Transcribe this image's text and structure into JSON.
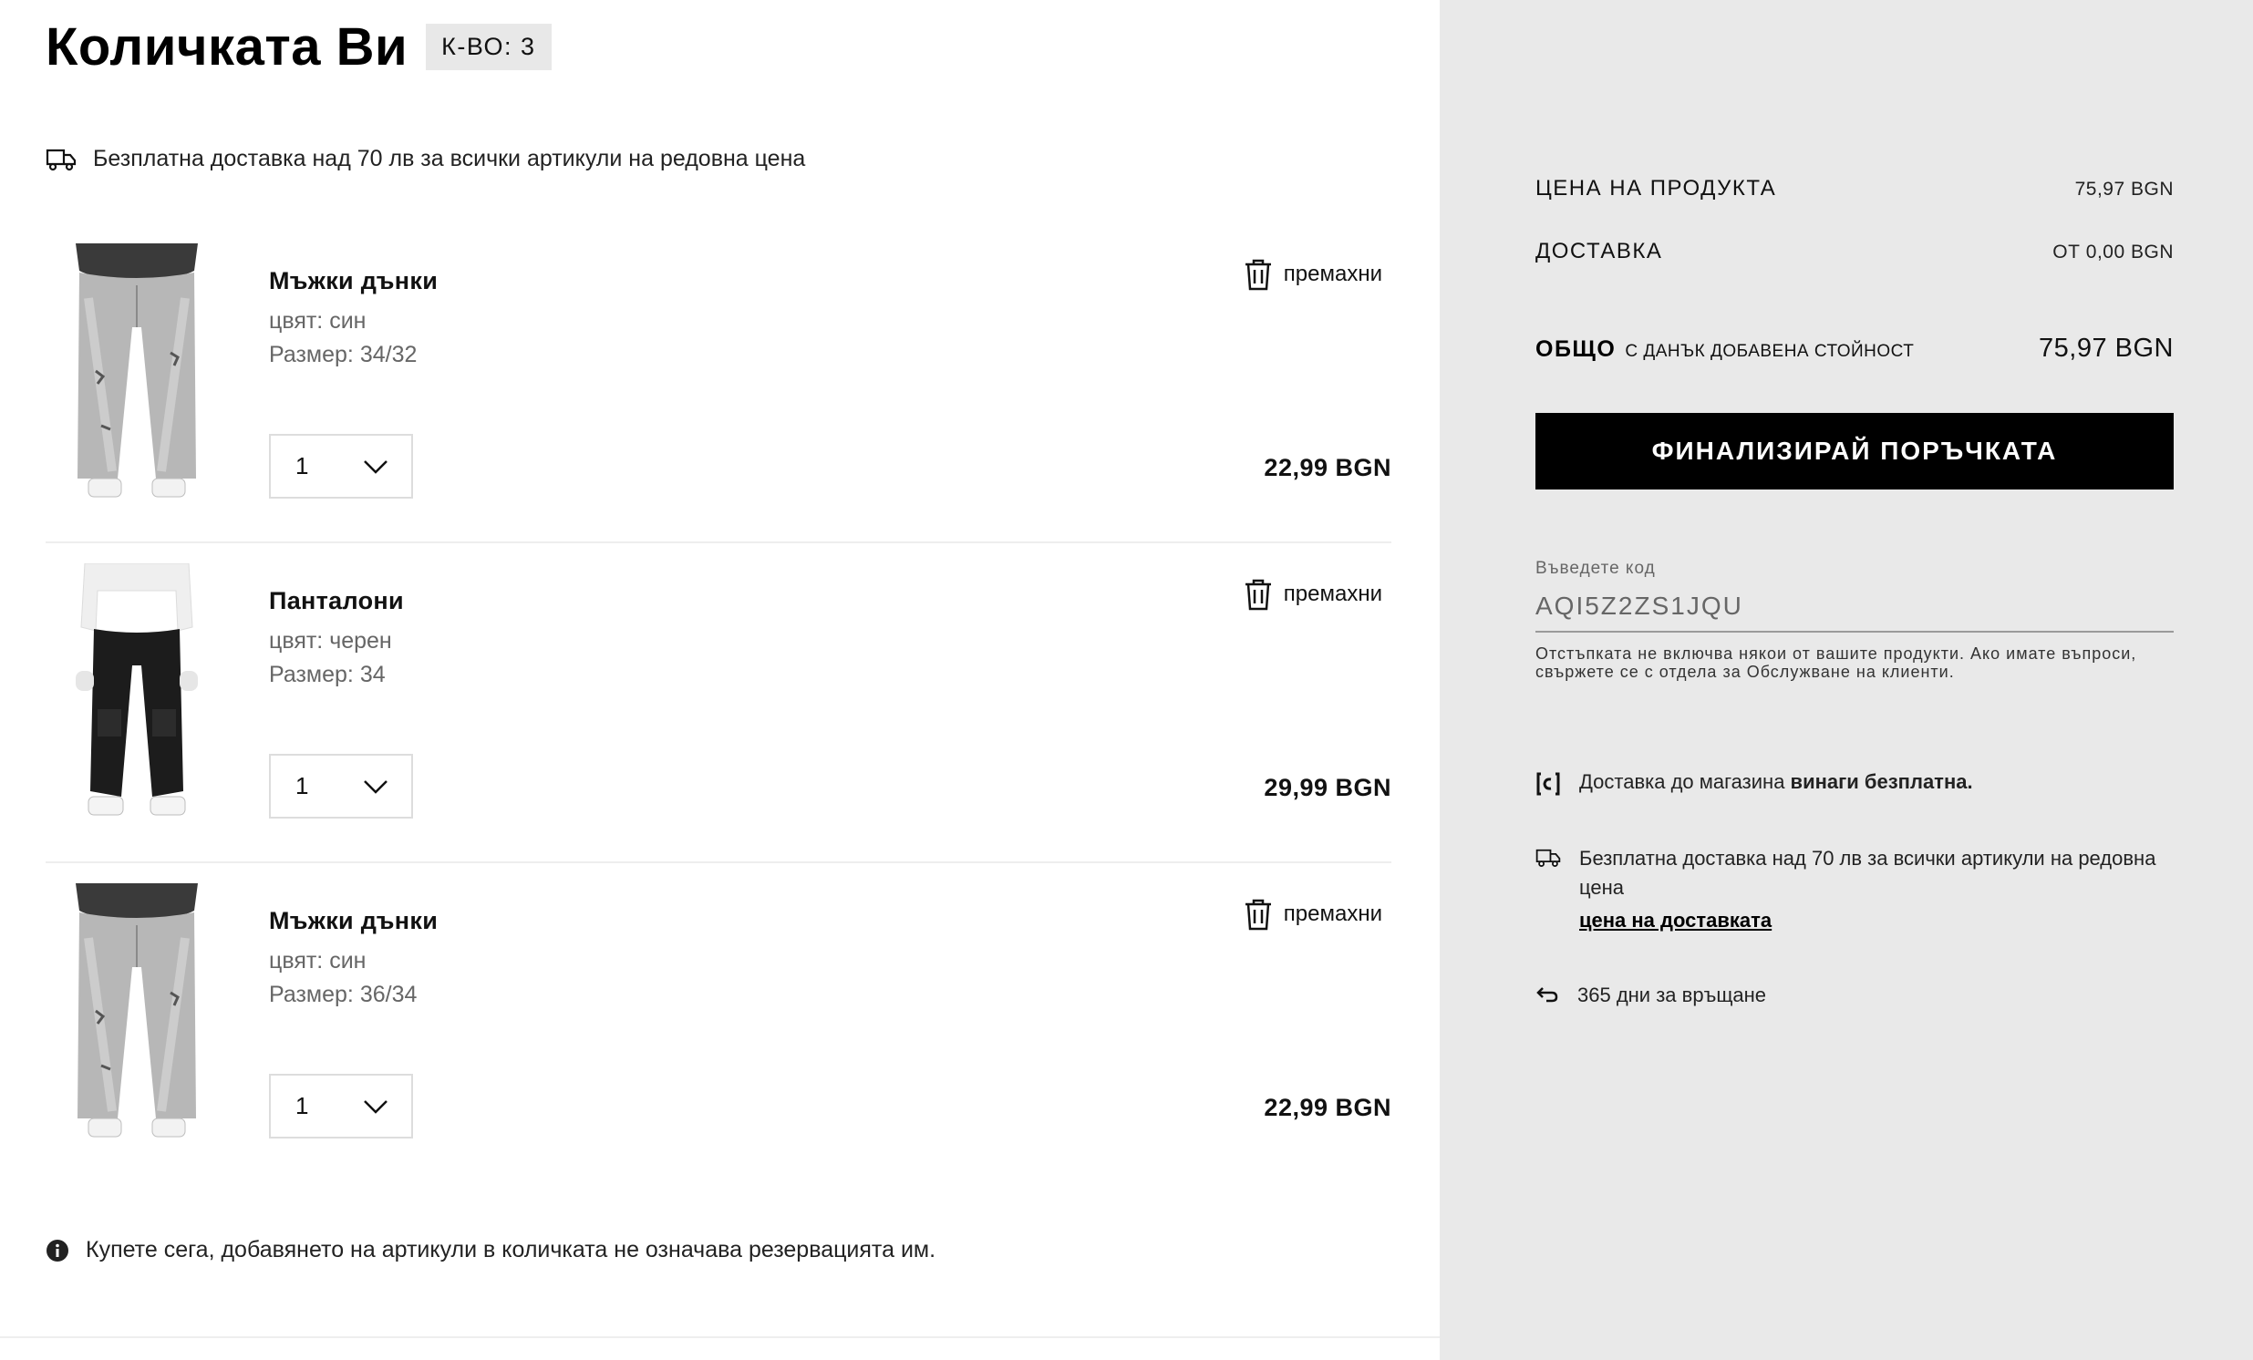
{
  "header": {
    "title": "Количката Ви",
    "count_badge": "К-ВО: 3"
  },
  "promo": {
    "text": "Безплатна доставка над 70 лв за всички артикули на редовна цена",
    "icon": "truck-icon"
  },
  "items": [
    {
      "name": "Мъжки дънки",
      "color": "цвят: син",
      "size": "Размер: 34/32",
      "qty": "1",
      "price": "22,99 BGN",
      "remove_label": "премахни",
      "image": "light-wash-ripped-jeans"
    },
    {
      "name": "Панталони",
      "color": "цвят: черен",
      "size": "Размер: 34",
      "qty": "1",
      "price": "29,99 BGN",
      "remove_label": "премахни",
      "image": "black-cargo-pants"
    },
    {
      "name": "Мъжки дънки",
      "color": "цвят: син",
      "size": "Размер: 36/34",
      "qty": "1",
      "price": "22,99 BGN",
      "remove_label": "премахни",
      "image": "light-wash-ripped-jeans"
    }
  ],
  "note": {
    "text": "Купете сега, добавянето на артикули в количката не означава резервацията им.",
    "icon": "info-icon"
  },
  "summary": {
    "product_price_label": "ЦЕНА НА ПРОДУКТА",
    "product_price_value": "75,97 BGN",
    "delivery_label": "ДОСТАВКА",
    "delivery_value": "ОТ 0,00 BGN",
    "total_label": "ОБЩО",
    "total_sub": "С ДАНЪК ДОБАВЕНА СТОЙНОСТ",
    "total_value": "75,97 BGN",
    "checkout_label": "ФИНАЛИЗИРАЙ ПОРЪЧКАТА"
  },
  "discount": {
    "label": "Въведете код",
    "value": "AQI5Z2ZS1JQU",
    "help": "Отстъпката не включва някои от вашите продукти. Ако имате въпроси, свържете се с отдела за Обслужване на клиенти."
  },
  "perks": {
    "store_delivery_prefix": "Доставка до магазина ",
    "store_delivery_bold": "винаги безплатна.",
    "free_shipping": "Безплатна доставка над 70 лв за всички артикули на редовна цена",
    "shipping_link": "цена на доставката",
    "returns": "365 дни за връщане"
  },
  "colors": {
    "panel_bg": "#e9e9e9",
    "button_bg": "#000000",
    "divider": "#eeeeee"
  }
}
